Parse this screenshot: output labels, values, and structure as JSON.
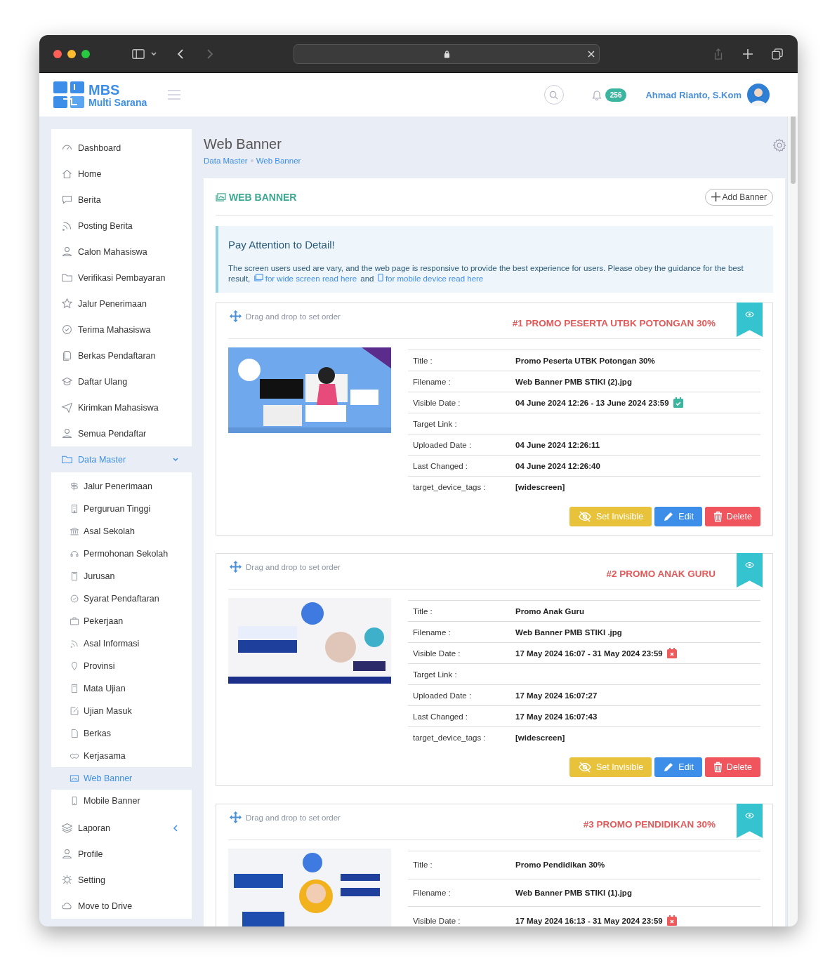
{
  "brand": {
    "name": "MBS",
    "subtitle": "Multi Sarana"
  },
  "header": {
    "notification_count": "256",
    "user_name": "Ahmad Rianto, S.Kom"
  },
  "sidebar": {
    "items": [
      {
        "label": "Dashboard",
        "selected": false
      },
      {
        "label": "Home",
        "selected": false
      },
      {
        "label": "Berita",
        "selected": false
      },
      {
        "label": "Posting Berita",
        "selected": false
      },
      {
        "label": "Calon Mahasiswa",
        "selected": false
      },
      {
        "label": "Verifikasi Pembayaran",
        "selected": false
      },
      {
        "label": "Jalur Penerimaan",
        "selected": false
      },
      {
        "label": "Terima Mahasiswa",
        "selected": false
      },
      {
        "label": "Berkas Pendaftaran",
        "selected": false
      },
      {
        "label": "Daftar Ulang",
        "selected": false
      },
      {
        "label": "Kirimkan Mahasiswa",
        "selected": false
      },
      {
        "label": "Semua Pendaftar",
        "selected": false
      },
      {
        "label": "Data Master",
        "expanded": true,
        "children": [
          {
            "label": "Jalur Penerimaan",
            "selected": false
          },
          {
            "label": "Perguruan Tinggi",
            "selected": false
          },
          {
            "label": "Asal Sekolah",
            "selected": false
          },
          {
            "label": "Permohonan Sekolah",
            "selected": false
          },
          {
            "label": "Jurusan",
            "selected": false
          },
          {
            "label": "Syarat Pendaftaran",
            "selected": false
          },
          {
            "label": "Pekerjaan",
            "selected": false
          },
          {
            "label": "Asal Informasi",
            "selected": false
          },
          {
            "label": "Provinsi",
            "selected": false
          },
          {
            "label": "Mata Ujian",
            "selected": false
          },
          {
            "label": "Ujian Masuk",
            "selected": false
          },
          {
            "label": "Berkas",
            "selected": false
          },
          {
            "label": "Kerjasama",
            "selected": false
          },
          {
            "label": "Web Banner",
            "selected": true
          },
          {
            "label": "Mobile Banner",
            "selected": false
          }
        ]
      },
      {
        "label": "Laporan",
        "expanded": false
      },
      {
        "label": "Profile",
        "selected": false
      },
      {
        "label": "Setting",
        "selected": false
      },
      {
        "label": "Move to Drive",
        "selected": false
      }
    ]
  },
  "page": {
    "title": "Web Banner",
    "breadcrumb": [
      "Data Master",
      "Web Banner"
    ]
  },
  "panel": {
    "title": "WEB BANNER",
    "add_button": "Add Banner",
    "notice": {
      "title": "Pay Attention to Detail!",
      "text": "The screen users used are vary, and the web page is responsive to provide the best experience for users. Please obey the guidance for the best result,",
      "link_wide": "for wide screen read here",
      "joiner": "and",
      "link_mobile": "for mobile device read here"
    }
  },
  "banners": [
    {
      "drag_hint": "Drag and drop to set order",
      "heading": "#1 PROMO PESERTA UTBK POTONGAN 30%",
      "expired": false,
      "fields": [
        {
          "label": "Title :",
          "value": "Promo Peserta UTBK Potongan 30%"
        },
        {
          "label": "Filename :",
          "value": "Web Banner PMB STIKI (2).jpg"
        },
        {
          "label": "Visible Date :",
          "value": "04 June 2024 12:26 - 13 June 2024 23:59",
          "kind": "date"
        },
        {
          "label": "Target Link :"
        },
        {
          "label": "Uploaded Date :",
          "value": "04 June 2024 12:26:11"
        },
        {
          "label": "Last Changed :",
          "value": "04 June 2024 12:26:40"
        },
        {
          "label": "target_device_tags :",
          "value": "[widescreen]"
        }
      ],
      "buttons": [
        "Set Invisible",
        "Edit",
        "Delete"
      ]
    },
    {
      "drag_hint": "Drag and drop to set order",
      "heading": "#2 PROMO ANAK GURU",
      "expired": true,
      "fields": [
        {
          "label": "Title :",
          "value": "Promo Anak Guru"
        },
        {
          "label": "Filename :",
          "value": "Web Banner PMB STIKI .jpg"
        },
        {
          "label": "Visible Date :",
          "value": "17 May 2024 16:07 - 31 May 2024 23:59",
          "kind": "date"
        },
        {
          "label": "Target Link :"
        },
        {
          "label": "Uploaded Date :",
          "value": "17 May 2024 16:07:27"
        },
        {
          "label": "Last Changed :",
          "value": "17 May 2024 16:07:43"
        },
        {
          "label": "target_device_tags :",
          "value": "[widescreen]"
        }
      ],
      "buttons": [
        "Set Invisible",
        "Edit",
        "Delete"
      ]
    },
    {
      "drag_hint": "Drag and drop to set order",
      "heading": "#3 PROMO PENDIDIKAN 30%",
      "expired": true,
      "fields": [
        {
          "label": "Title :",
          "value": "Promo Pendidikan 30%"
        },
        {
          "label": "Filename :",
          "value": "Web Banner PMB STIKI (1).jpg"
        },
        {
          "label": "Visible Date :",
          "value": "17 May 2024 16:13 - 31 May 2024 23:59",
          "kind": "date"
        }
      ]
    }
  ]
}
